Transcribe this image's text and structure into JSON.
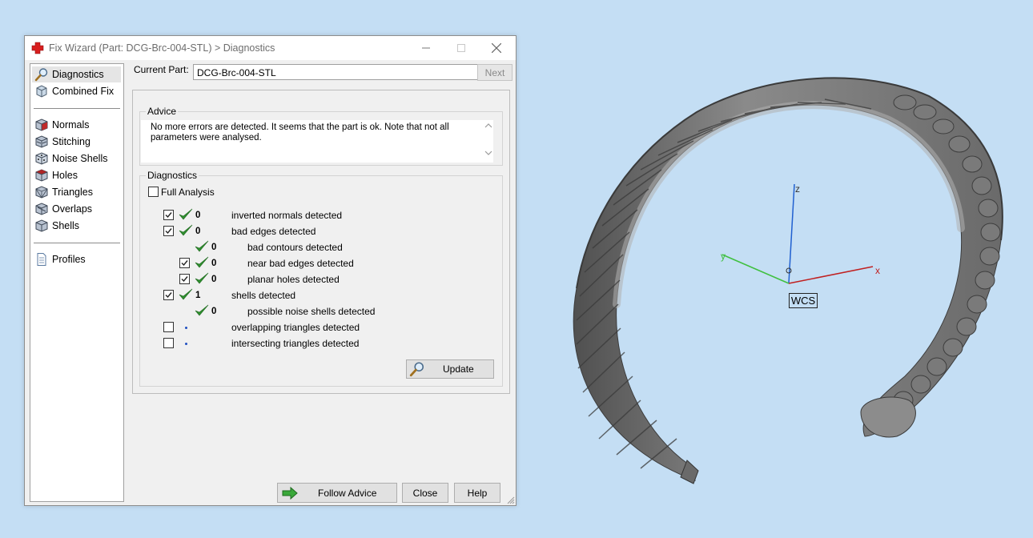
{
  "window": {
    "title": "Fix Wizard (Part: DCG-Brc-004-STL) > Diagnostics"
  },
  "nav": {
    "items": [
      {
        "label": "Diagnostics",
        "icon": "magnifier-icon"
      },
      {
        "label": "Combined Fix",
        "icon": "combined-fix-icon"
      },
      {
        "label": "Normals",
        "icon": "normals-cube-icon"
      },
      {
        "label": "Stitching",
        "icon": "stitching-cube-icon"
      },
      {
        "label": "Noise Shells",
        "icon": "noise-shells-dice-icon"
      },
      {
        "label": "Holes",
        "icon": "holes-cube-icon"
      },
      {
        "label": "Triangles",
        "icon": "triangles-cube-icon"
      },
      {
        "label": "Overlaps",
        "icon": "overlaps-cube-icon"
      },
      {
        "label": "Shells",
        "icon": "shells-cube-icon"
      },
      {
        "label": "Profiles",
        "icon": "document-icon"
      }
    ],
    "selected": "Diagnostics"
  },
  "current_part": {
    "label": "Current Part:",
    "value": "DCG-Brc-004-STL"
  },
  "next_label": "Next",
  "advice": {
    "title": "Advice",
    "text": "No more errors are detected. It seems that the part is ok. Note that not all parameters were analysed."
  },
  "diagnostics": {
    "title": "Diagnostics",
    "full_analysis_label": "Full Analysis",
    "full_analysis_checked": false,
    "rows": [
      {
        "checkbox": true,
        "checked": true,
        "status": "ok",
        "count": "0",
        "label": "inverted normals detected",
        "indent": 0
      },
      {
        "checkbox": true,
        "checked": true,
        "status": "ok",
        "count": "0",
        "label": "bad edges detected",
        "indent": 0
      },
      {
        "checkbox": false,
        "checked": false,
        "status": "ok",
        "count": "0",
        "label": "bad contours detected",
        "indent": 1
      },
      {
        "checkbox": true,
        "checked": true,
        "status": "ok",
        "count": "0",
        "label": "near bad edges detected",
        "indent": 1
      },
      {
        "checkbox": true,
        "checked": true,
        "status": "ok",
        "count": "0",
        "label": "planar holes detected",
        "indent": 1
      },
      {
        "checkbox": true,
        "checked": true,
        "status": "ok",
        "count": "1",
        "label": "shells detected",
        "indent": 0
      },
      {
        "checkbox": false,
        "checked": false,
        "status": "ok",
        "count": "0",
        "label": "possible noise shells detected",
        "indent": 1
      },
      {
        "checkbox": true,
        "checked": false,
        "status": "pending",
        "count": "",
        "label": "overlapping triangles detected",
        "indent": 0
      },
      {
        "checkbox": true,
        "checked": false,
        "status": "pending",
        "count": "",
        "label": "intersecting triangles detected",
        "indent": 0
      }
    ],
    "update_label": "Update"
  },
  "footer": {
    "follow_advice_label": "Follow Advice",
    "close_label": "Close",
    "help_label": "Help"
  },
  "viewport": {
    "background": "#c4def4",
    "axes": {
      "x": "x",
      "y": "y",
      "z": "z"
    },
    "wcs_label": "WCS"
  },
  "colors": {
    "check_green": "#2f8f2f",
    "axis_x": "#c02020",
    "axis_y": "#40c040",
    "axis_z": "#2060d0"
  }
}
